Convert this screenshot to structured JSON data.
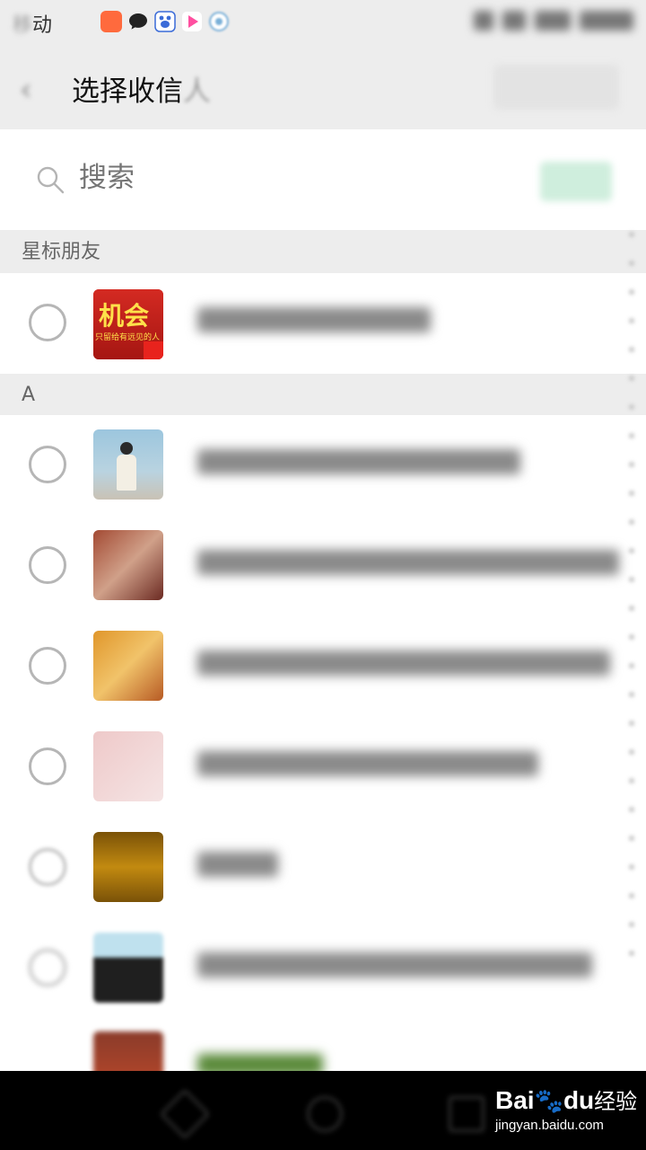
{
  "status_bar": {
    "carrier_visible": "动",
    "carrier_faded": "移",
    "icons": [
      {
        "name": "kuaishou-icon",
        "color": "#ff6a3d"
      },
      {
        "name": "message-bubble-icon",
        "color": "#222222"
      },
      {
        "name": "baidu-paw-icon",
        "color": "#3a6bd8"
      },
      {
        "name": "play-video-icon",
        "color": "#ff4fa0"
      },
      {
        "name": "wandoujia-icon",
        "color": "#7ab0d8"
      }
    ]
  },
  "header": {
    "back_icon": "back-arrow-icon",
    "title_visible": "选择收信",
    "title_faded": "人"
  },
  "search": {
    "placeholder": "搜索"
  },
  "sections": [
    {
      "title": "星标朋友"
    },
    {
      "title": "A"
    }
  ],
  "contacts": [
    {
      "section": "星标朋友",
      "avatar_text_main": "机会",
      "avatar_text_sub": "只留给有远见的人",
      "avatar_colors": [
        "#c8201e",
        "#8c1010"
      ]
    },
    {
      "section": "A",
      "avatar_colors": [
        "#9cc6de",
        "#e8e2d6"
      ]
    },
    {
      "section": "A",
      "avatar_colors": [
        "#a34a33",
        "#6b2a22"
      ]
    },
    {
      "section": "A",
      "avatar_colors": [
        "#e0962a",
        "#b75a24"
      ]
    },
    {
      "section": "A",
      "avatar_colors": [
        "#eec9c9",
        "#f5e4e4"
      ]
    },
    {
      "section": "A",
      "avatar_colors": [
        "#c28a10",
        "#7a5208"
      ]
    },
    {
      "section": "A",
      "avatar_colors": [
        "#bfe1ee",
        "#1f1f1f"
      ]
    },
    {
      "section": "A",
      "avatar_colors": [
        "#8a3b2a",
        "#c24a2a"
      ]
    }
  ],
  "watermark": {
    "brand_a": "Bai",
    "brand_b": "du",
    "brand_suffix": "经验",
    "url": "jingyan.baidu.com"
  }
}
